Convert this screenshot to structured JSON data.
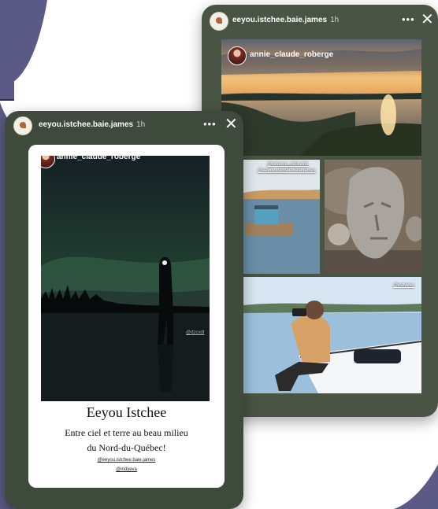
{
  "colors": {
    "background": "#5b5a86",
    "blob": "#ffffff",
    "story_bg": "#3f4a3d"
  },
  "back_story": {
    "account": "eeyou.istchee.baie.james",
    "time": "1h",
    "more_icon": "more-horizontal-icon",
    "close_icon": "close-icon",
    "creator": "annie_claude_roberge",
    "tags": [
      "@reserve_nibiischii",
      "@eeyou.istchee.baie.james",
      "@indyeva"
    ]
  },
  "front_story": {
    "account": "eeyou.istchee.baie.james",
    "time": "1h",
    "more_icon": "more-horizontal-icon",
    "close_icon": "close-icon",
    "creator": "annie_claude_roberge",
    "photo_tag": "@dzcxdt",
    "title": "Eeyou Istchee",
    "subtitle_line1": "Entre ciel et terre au beau milieu",
    "subtitle_line2": "du Nord-du-Québec!",
    "footer_tag1": "@eeyou.istchee.baie.james",
    "footer_tag2": "@indyeva"
  }
}
